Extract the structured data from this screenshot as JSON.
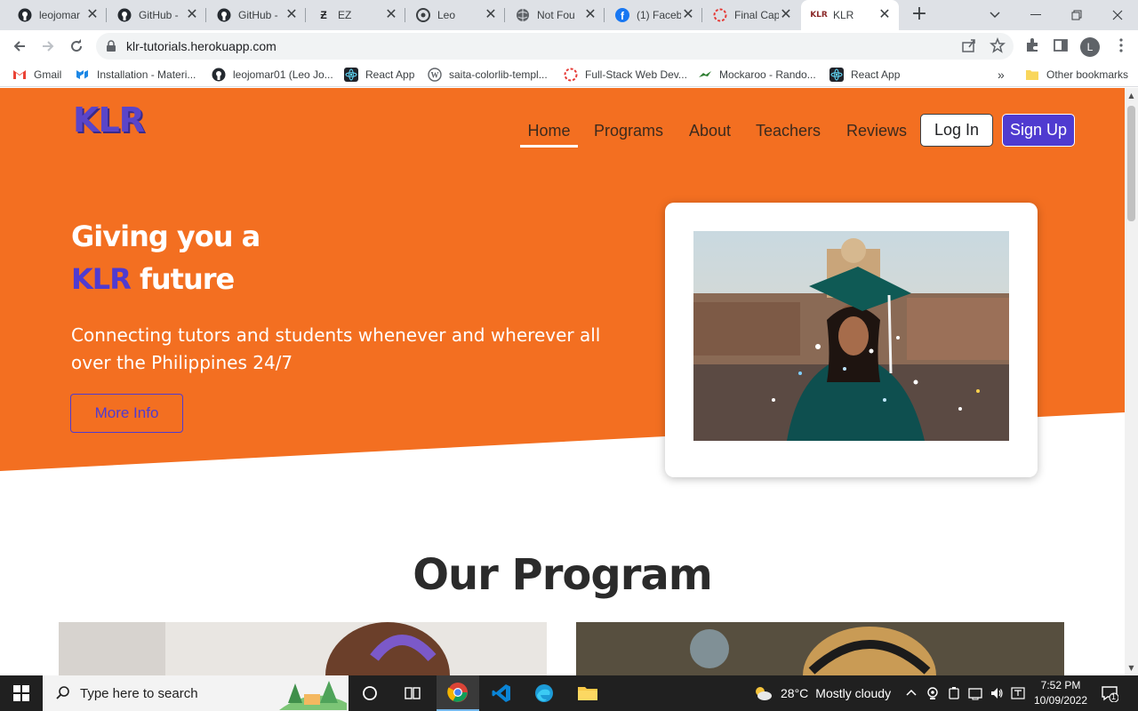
{
  "browser": {
    "tabs": [
      {
        "title": "leojomar",
        "icon": "github-icon"
      },
      {
        "title": "GitHub -",
        "icon": "github-icon"
      },
      {
        "title": "GitHub -",
        "icon": "github-icon"
      },
      {
        "title": "EZ",
        "icon": "ez-icon"
      },
      {
        "title": "Leo",
        "icon": "leo-icon"
      },
      {
        "title": "Not Fou",
        "icon": "globe-icon"
      },
      {
        "title": "(1) Faceb",
        "icon": "facebook-icon"
      },
      {
        "title": "Final Cap",
        "icon": "loading-icon"
      },
      {
        "title": "KLR",
        "icon": "klr-icon"
      }
    ],
    "url": "klr-tutorials.herokuapp.com",
    "profile_initial": "L",
    "bookmarks": [
      {
        "label": "Gmail",
        "icon": "gmail-icon"
      },
      {
        "label": "Installation - Materi...",
        "icon": "mui-icon"
      },
      {
        "label": "leojomar01 (Leo Jo...",
        "icon": "github-icon"
      },
      {
        "label": "React App",
        "icon": "react-icon"
      },
      {
        "label": "saita-colorlib-templ...",
        "icon": "wordpress-icon"
      },
      {
        "label": "Full-Stack Web Dev...",
        "icon": "loading-icon"
      },
      {
        "label": "Mockaroo - Rando...",
        "icon": "mockaroo-icon"
      },
      {
        "label": "React App",
        "icon": "react-icon"
      }
    ],
    "more_bookmarks": "»",
    "other_bookmarks": "Other bookmarks"
  },
  "site": {
    "logo": "KLR",
    "nav": {
      "home": "Home",
      "programs": "Programs",
      "about": "About",
      "teachers": "Teachers",
      "reviews": "Reviews"
    },
    "login": "Log In",
    "signup": "Sign Up",
    "hero": {
      "line1": "Giving you a",
      "accent": "KLR",
      "line2_rest": " future",
      "subtext": "Connecting tutors and students whenever and wherever all over the Philippines 24/7",
      "cta": "More Info"
    },
    "section_title": "Our Program"
  },
  "taskbar": {
    "search_placeholder": "Type here to search",
    "weather_temp": "28°C",
    "weather_text": "Mostly cloudy",
    "time": "7:52 PM",
    "date": "10/09/2022",
    "notifications": "1"
  },
  "colors": {
    "hero_orange": "#f36f21",
    "accent_purple": "#4f3bd0"
  }
}
